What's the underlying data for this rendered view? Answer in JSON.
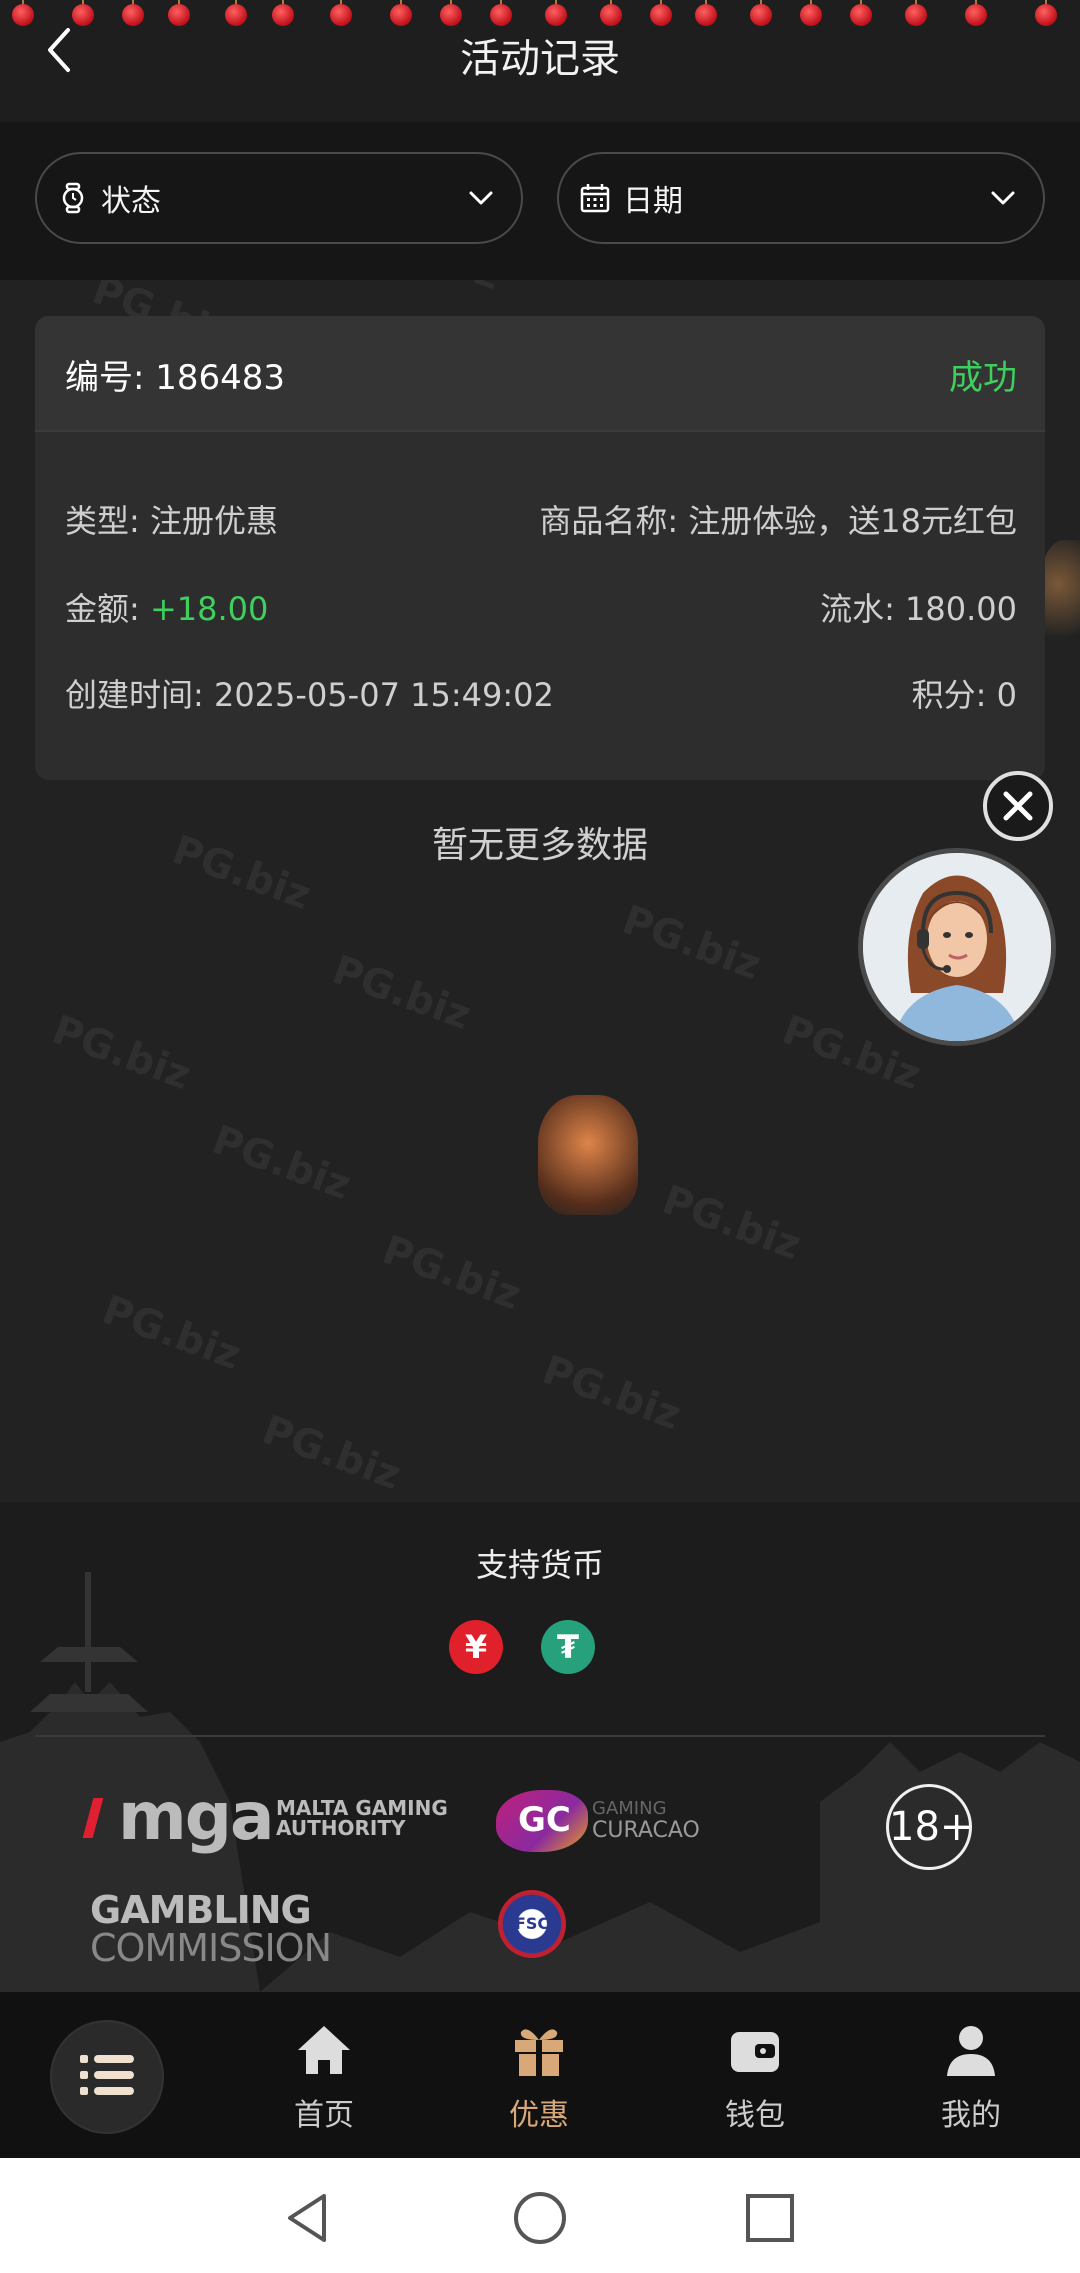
{
  "header": {
    "title": "活动记录",
    "back_icon": "chevron-left-icon"
  },
  "filters": [
    {
      "label": "状态",
      "icon": "watch-icon"
    },
    {
      "label": "日期",
      "icon": "calendar-icon"
    }
  ],
  "record": {
    "id_label": "编号: 186483",
    "status": "成功",
    "type_label": "类型: 注册优惠",
    "product_label": "商品名称: 注册体验，送18元红包",
    "amount_prefix": "金额: ",
    "amount_value": "+18.00",
    "turnover_label": "流水: 180.00",
    "created_label": "创建时间: 2025-05-07 15:49:02",
    "points_label": "积分: 0"
  },
  "empty_message": "暂无更多数据",
  "footer": {
    "currency_title": "支持货币",
    "currencies": [
      "¥",
      "₮"
    ],
    "licenses": {
      "mga_main": "mga",
      "mga_sub1": "MALTA GAMING",
      "mga_sub2": "AUTHORITY",
      "gc_mark": "GC",
      "gc_sub1": "GAMING",
      "gc_sub2": "CURACAO",
      "age": "18+",
      "gambling1": "GAMBLING",
      "gambling2": "COMMISSION",
      "fsc": "FSC"
    }
  },
  "nav": [
    {
      "label": "首页",
      "icon": "home-icon"
    },
    {
      "label": "优惠",
      "icon": "gift-icon"
    },
    {
      "label": "钱包",
      "icon": "wallet-icon"
    },
    {
      "label": "我的",
      "icon": "user-icon"
    }
  ],
  "colors": {
    "success": "#3fcf5e",
    "accent": "#d8a878",
    "background": "#222222"
  },
  "watermark": "PG.biz"
}
